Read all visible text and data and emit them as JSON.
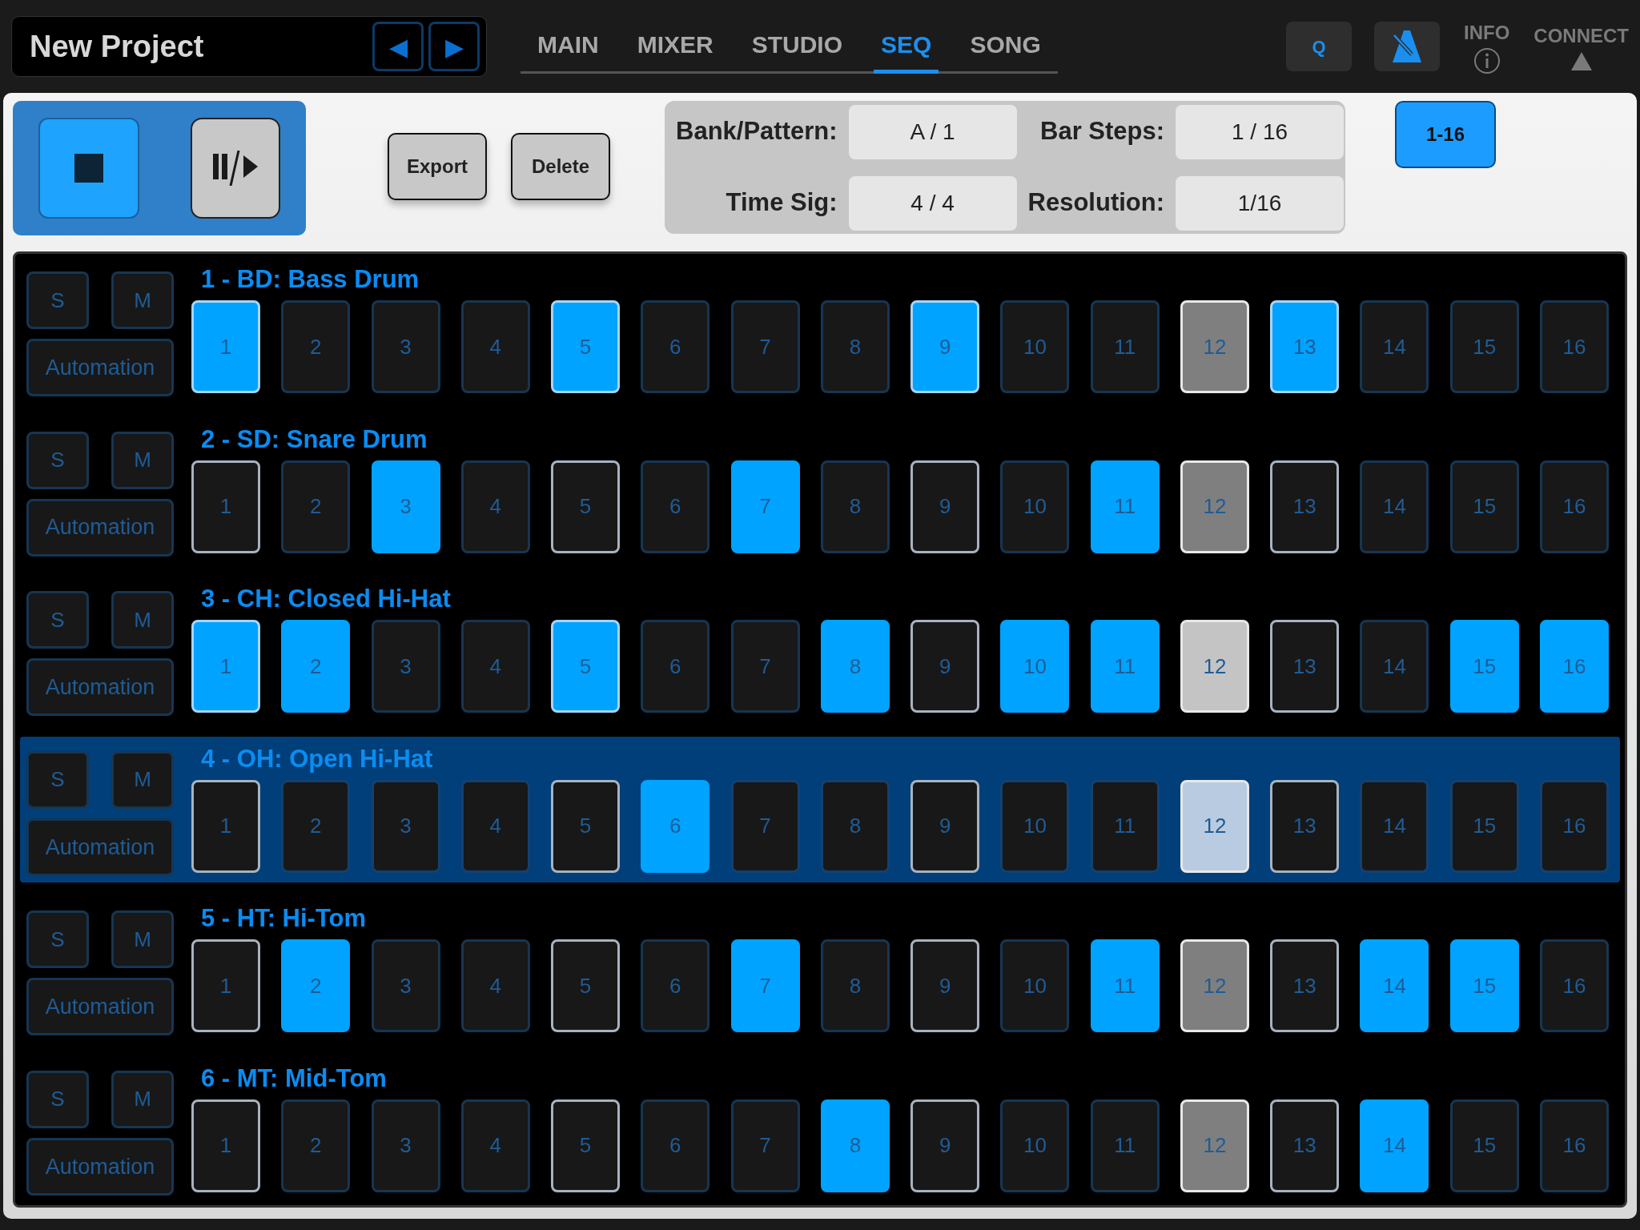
{
  "project": {
    "title": "New Project",
    "prev": "◀",
    "next": "▶"
  },
  "tabs": [
    {
      "label": "MAIN",
      "selected": false
    },
    {
      "label": "MIXER",
      "selected": false
    },
    {
      "label": "STUDIO",
      "selected": false
    },
    {
      "label": "SEQ",
      "selected": true
    },
    {
      "label": "SONG",
      "selected": false
    }
  ],
  "top_right": {
    "quantize": "Q",
    "info": "INFO",
    "connect": "CONNECT"
  },
  "transport": {
    "playing": true
  },
  "actions": [
    "Export",
    "Delete"
  ],
  "pattern_info": [
    {
      "label": "Bank/Pattern:",
      "value": "A / 1"
    },
    {
      "label": "Bar Steps:",
      "value": "1 / 16"
    },
    {
      "label": "Time Sig:",
      "value": "4 / 4"
    },
    {
      "label": "Resolution:",
      "value": "1/16"
    }
  ],
  "page_button": {
    "label": "1-16",
    "selected": true
  },
  "tracks": [
    {
      "name": "1 - BD: Bass Drum",
      "selected": false,
      "solo": "S",
      "mute": "M",
      "automation": "Automation",
      "steps": [
        {
          "label": "1",
          "on": true,
          "beat": true,
          "current": false
        },
        {
          "label": "2",
          "on": false,
          "beat": false,
          "current": false
        },
        {
          "label": "3",
          "on": false,
          "beat": false,
          "current": false
        },
        {
          "label": "4",
          "on": false,
          "beat": false,
          "current": false
        },
        {
          "label": "5",
          "on": true,
          "beat": true,
          "current": false
        },
        {
          "label": "6",
          "on": false,
          "beat": false,
          "current": false
        },
        {
          "label": "7",
          "on": false,
          "beat": false,
          "current": false
        },
        {
          "label": "8",
          "on": false,
          "beat": false,
          "current": false
        },
        {
          "label": "9",
          "on": true,
          "beat": true,
          "current": false
        },
        {
          "label": "10",
          "on": false,
          "beat": false,
          "current": false
        },
        {
          "label": "11",
          "on": false,
          "beat": false,
          "current": false
        },
        {
          "label": "12",
          "on": false,
          "beat": false,
          "current": true
        },
        {
          "label": "13",
          "on": true,
          "beat": true,
          "current": false
        },
        {
          "label": "14",
          "on": false,
          "beat": false,
          "current": false
        },
        {
          "label": "15",
          "on": false,
          "beat": false,
          "current": false
        },
        {
          "label": "16",
          "on": false,
          "beat": false,
          "current": false
        }
      ]
    },
    {
      "name": "2 - SD: Snare Drum",
      "selected": false,
      "solo": "S",
      "mute": "M",
      "automation": "Automation",
      "steps": [
        {
          "label": "1",
          "on": false,
          "beat": true,
          "current": false
        },
        {
          "label": "2",
          "on": false,
          "beat": false,
          "current": false
        },
        {
          "label": "3",
          "on": true,
          "beat": false,
          "current": false
        },
        {
          "label": "4",
          "on": false,
          "beat": false,
          "current": false
        },
        {
          "label": "5",
          "on": false,
          "beat": true,
          "current": false
        },
        {
          "label": "6",
          "on": false,
          "beat": false,
          "current": false
        },
        {
          "label": "7",
          "on": true,
          "beat": false,
          "current": false
        },
        {
          "label": "8",
          "on": false,
          "beat": false,
          "current": false
        },
        {
          "label": "9",
          "on": false,
          "beat": true,
          "current": false
        },
        {
          "label": "10",
          "on": false,
          "beat": false,
          "current": false
        },
        {
          "label": "11",
          "on": true,
          "beat": false,
          "current": false
        },
        {
          "label": "12",
          "on": false,
          "beat": false,
          "current": true
        },
        {
          "label": "13",
          "on": false,
          "beat": true,
          "current": false
        },
        {
          "label": "14",
          "on": false,
          "beat": false,
          "current": false
        },
        {
          "label": "15",
          "on": false,
          "beat": false,
          "current": false
        },
        {
          "label": "16",
          "on": false,
          "beat": false,
          "current": false
        }
      ]
    },
    {
      "name": "3 - CH: Closed Hi-Hat",
      "selected": false,
      "solo": "S",
      "mute": "M",
      "automation": "Automation",
      "steps": [
        {
          "label": "1",
          "on": true,
          "beat": true,
          "current": false
        },
        {
          "label": "2",
          "on": true,
          "beat": false,
          "current": false
        },
        {
          "label": "3",
          "on": false,
          "beat": false,
          "current": false
        },
        {
          "label": "4",
          "on": false,
          "beat": false,
          "current": false
        },
        {
          "label": "5",
          "on": true,
          "beat": true,
          "current": false
        },
        {
          "label": "6",
          "on": false,
          "beat": false,
          "current": false
        },
        {
          "label": "7",
          "on": false,
          "beat": false,
          "current": false
        },
        {
          "label": "8",
          "on": true,
          "beat": false,
          "current": false
        },
        {
          "label": "9",
          "on": false,
          "beat": true,
          "current": false
        },
        {
          "label": "10",
          "on": true,
          "beat": false,
          "current": false
        },
        {
          "label": "11",
          "on": true,
          "beat": false,
          "current": false
        },
        {
          "label": "12",
          "on": true,
          "beat": false,
          "current": true
        },
        {
          "label": "13",
          "on": false,
          "beat": true,
          "current": false
        },
        {
          "label": "14",
          "on": false,
          "beat": false,
          "current": false
        },
        {
          "label": "15",
          "on": true,
          "beat": false,
          "current": false
        },
        {
          "label": "16",
          "on": true,
          "beat": false,
          "current": false
        }
      ]
    },
    {
      "name": "4 - OH: Open Hi-Hat",
      "selected": true,
      "solo": "S",
      "mute": "M",
      "automation": "Automation",
      "steps": [
        {
          "label": "1",
          "on": false,
          "beat": true,
          "current": false
        },
        {
          "label": "2",
          "on": false,
          "beat": false,
          "current": false
        },
        {
          "label": "3",
          "on": false,
          "beat": false,
          "current": false
        },
        {
          "label": "4",
          "on": false,
          "beat": false,
          "current": false
        },
        {
          "label": "5",
          "on": false,
          "beat": true,
          "current": false
        },
        {
          "label": "6",
          "on": true,
          "beat": false,
          "current": false
        },
        {
          "label": "7",
          "on": false,
          "beat": false,
          "current": false
        },
        {
          "label": "8",
          "on": false,
          "beat": false,
          "current": false
        },
        {
          "label": "9",
          "on": false,
          "beat": true,
          "current": false
        },
        {
          "label": "10",
          "on": false,
          "beat": false,
          "current": false
        },
        {
          "label": "11",
          "on": false,
          "beat": false,
          "current": false
        },
        {
          "label": "12",
          "on": false,
          "beat": false,
          "current": true
        },
        {
          "label": "13",
          "on": false,
          "beat": true,
          "current": false
        },
        {
          "label": "14",
          "on": false,
          "beat": false,
          "current": false
        },
        {
          "label": "15",
          "on": false,
          "beat": false,
          "current": false
        },
        {
          "label": "16",
          "on": false,
          "beat": false,
          "current": false
        }
      ]
    },
    {
      "name": "5 - HT: Hi-Tom",
      "selected": false,
      "solo": "S",
      "mute": "M",
      "automation": "Automation",
      "steps": [
        {
          "label": "1",
          "on": false,
          "beat": true,
          "current": false
        },
        {
          "label": "2",
          "on": true,
          "beat": false,
          "current": false
        },
        {
          "label": "3",
          "on": false,
          "beat": false,
          "current": false
        },
        {
          "label": "4",
          "on": false,
          "beat": false,
          "current": false
        },
        {
          "label": "5",
          "on": false,
          "beat": true,
          "current": false
        },
        {
          "label": "6",
          "on": false,
          "beat": false,
          "current": false
        },
        {
          "label": "7",
          "on": true,
          "beat": false,
          "current": false
        },
        {
          "label": "8",
          "on": false,
          "beat": false,
          "current": false
        },
        {
          "label": "9",
          "on": false,
          "beat": true,
          "current": false
        },
        {
          "label": "10",
          "on": false,
          "beat": false,
          "current": false
        },
        {
          "label": "11",
          "on": true,
          "beat": false,
          "current": false
        },
        {
          "label": "12",
          "on": false,
          "beat": false,
          "current": true
        },
        {
          "label": "13",
          "on": false,
          "beat": true,
          "current": false
        },
        {
          "label": "14",
          "on": true,
          "beat": false,
          "current": false
        },
        {
          "label": "15",
          "on": true,
          "beat": false,
          "current": false
        },
        {
          "label": "16",
          "on": false,
          "beat": false,
          "current": false
        }
      ]
    },
    {
      "name": "6 - MT: Mid-Tom",
      "selected": false,
      "solo": "S",
      "mute": "M",
      "automation": "Automation",
      "steps": [
        {
          "label": "1",
          "on": false,
          "beat": true,
          "current": false
        },
        {
          "label": "2",
          "on": false,
          "beat": false,
          "current": false
        },
        {
          "label": "3",
          "on": false,
          "beat": false,
          "current": false
        },
        {
          "label": "4",
          "on": false,
          "beat": false,
          "current": false
        },
        {
          "label": "5",
          "on": false,
          "beat": true,
          "current": false
        },
        {
          "label": "6",
          "on": false,
          "beat": false,
          "current": false
        },
        {
          "label": "7",
          "on": false,
          "beat": false,
          "current": false
        },
        {
          "label": "8",
          "on": true,
          "beat": false,
          "current": false
        },
        {
          "label": "9",
          "on": false,
          "beat": true,
          "current": false
        },
        {
          "label": "10",
          "on": false,
          "beat": false,
          "current": false
        },
        {
          "label": "11",
          "on": false,
          "beat": false,
          "current": false
        },
        {
          "label": "12",
          "on": false,
          "beat": false,
          "current": true
        },
        {
          "label": "13",
          "on": false,
          "beat": true,
          "current": false
        },
        {
          "label": "14",
          "on": true,
          "beat": false,
          "current": false
        },
        {
          "label": "15",
          "on": false,
          "beat": false,
          "current": false
        },
        {
          "label": "16",
          "on": false,
          "beat": false,
          "current": false
        }
      ]
    }
  ]
}
